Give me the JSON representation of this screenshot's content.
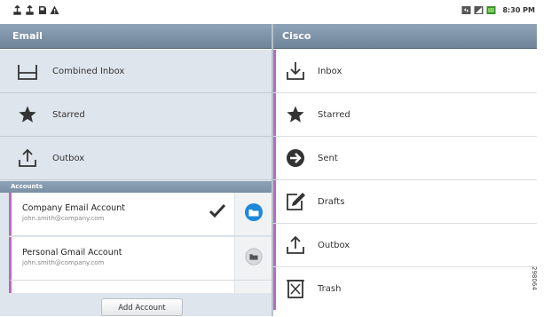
{
  "status_bar": {
    "left_icons": [
      "usb-icon",
      "usb-icon",
      "sd-card-icon",
      "warning-icon"
    ],
    "right_icons": [
      "sync-icon",
      "signal-icon",
      "battery-icon"
    ],
    "time": "8:30 PM"
  },
  "left_pane": {
    "title": "Email",
    "items": [
      {
        "icon": "inbox-tray-icon",
        "label": "Combined Inbox",
        "badge": ""
      },
      {
        "icon": "star-icon",
        "label": "Starred",
        "badge": ""
      },
      {
        "icon": "outbox-icon",
        "label": "Outbox",
        "badge": ""
      }
    ],
    "accounts_header": "Accounts",
    "accounts": [
      {
        "name": "Company Email Account",
        "email": "john.smith@company.com",
        "checked": true
      },
      {
        "name": "Personal Gmail Account",
        "email": "john.smith@company.com",
        "checked": false
      }
    ],
    "add_account_label": "Add Account"
  },
  "right_pane": {
    "title": "Cisco",
    "folders": [
      {
        "icon": "inbox-download-icon",
        "label": "Inbox"
      },
      {
        "icon": "star-icon",
        "label": "Starred"
      },
      {
        "icon": "sent-arrow-icon",
        "label": "Sent"
      },
      {
        "icon": "drafts-pencil-icon",
        "label": "Drafts"
      },
      {
        "icon": "outbox-icon",
        "label": "Outbox"
      },
      {
        "icon": "trash-icon",
        "label": "Trash"
      }
    ]
  },
  "watermark": "298064",
  "colors": {
    "header": "#7b8fa4",
    "accent": "#b86bc0",
    "left_bg": "#dfe5ec",
    "folder_button": "#1e88d8"
  }
}
